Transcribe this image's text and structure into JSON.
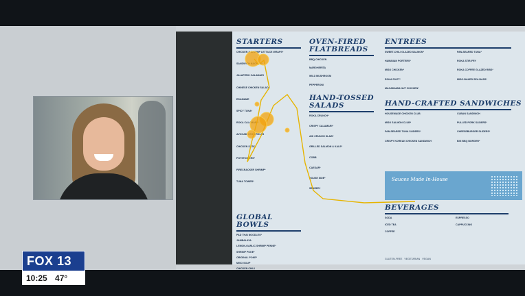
{
  "overlay": {
    "station": "FOX 13",
    "time": "10:25",
    "temperature": "47°"
  },
  "menu": {
    "starters": {
      "title": "Starters",
      "items": [
        "CHICKEN & SHRIMP LETTUCE WRAPS*",
        "SANDWICH NACHOS*",
        "JALAPEÑO CALAMARI",
        "CHINESE CHICKEN SALAD",
        "EDAMAME",
        "SPICY TUNA*",
        "ROKA CALAMARI*",
        "AVOCADO EGG ROLLS",
        "CHICKEN SATAY",
        "POTSTICKERS*",
        "FIRECRACKER SHRIMP*",
        "TUNA TOWER*"
      ]
    },
    "flatbreads": {
      "title": "Oven-Fired Flatbreads",
      "items": [
        "BBQ CHICKEN",
        "MARGHERITA",
        "WILD MUSHROOM",
        "PEPPERONI"
      ]
    },
    "salads": {
      "title": "Hand-Tossed Salads",
      "items": [
        "ROKA CRUNCH*",
        "CRISPY CALAMARI*",
        "AHI CRUNCH SLAW*",
        "GRILLED SALMON & KALE*",
        "COBB",
        "CAESAR*",
        "HOUSE SIDE*",
        "SEARED*"
      ]
    },
    "bowls": {
      "title": "Global Bowls",
      "items": [
        "PAD THAI NOODLES*",
        "JAMBALAYA",
        "LEMON-GARLIC SHRIMP PENNE*",
        "SHRIMP POKE*",
        "ORIGINAL POKE*",
        "MISO SOUP",
        "CHICKEN CHILI"
      ]
    },
    "entrees": {
      "title": "Entrees",
      "items": [
        "SWEET-CHILI GLAZED SALMON*",
        "HAWAIIAN PORTERS*",
        "MISO CHICKEN*",
        "ROKA FILET*",
        "MACADAMIA NUT CHICKEN*",
        "PAN-SEARED TUNA*",
        "ROKA STIR-FRY",
        "ROKA COFFEE GLAZED RIBS*",
        "MISO-BAKED SEA BASS*"
      ]
    },
    "sandwiches": {
      "title": "Hand-Crafted Sandwiches",
      "items": [
        "HOUSEMADE CHICKEN CLUB",
        "MISO SALMON CLUB*",
        "PAN-SEARED TUNA SLIDERS*",
        "CRISPY KOREAN CHICKEN SANDWICH",
        "CUBAN SANDWICH",
        "PULLED PORK SLIDERS*",
        "CHEESEBURGER SLIDERS*",
        "BIG BBQ BURGER*"
      ]
    },
    "sauces": {
      "title": "Sauces Made In-House"
    },
    "beverages": {
      "title": "Beverages",
      "items": [
        "SODA",
        "ICED TEA",
        "COFFEE",
        "ESPRESSO",
        "CAPPUCCINO"
      ]
    },
    "legend": {
      "gluten_free": "GLUTEN-FREE",
      "vegetarian": "VEGETARIAN",
      "vegan": "VEGAN"
    }
  },
  "colors": {
    "menu_heading": "#1d3e6b",
    "gaze_fill": "#f2a20c",
    "gaze_line": "#e6b400",
    "sauce_banner": "#6aa6cf",
    "logo_blue": "#1b3f8f"
  }
}
